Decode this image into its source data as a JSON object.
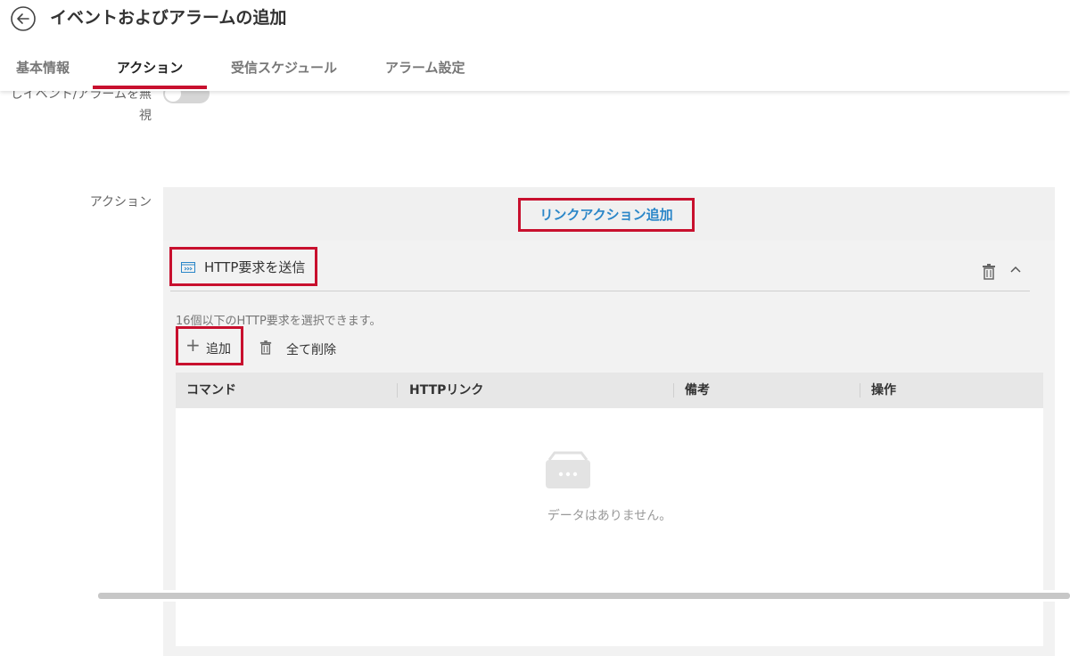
{
  "header": {
    "title": "イベントおよびアラームの追加",
    "tabs": [
      {
        "label": "基本情報",
        "active": false
      },
      {
        "label": "アクション",
        "active": true
      },
      {
        "label": "受信スケジュール",
        "active": false
      },
      {
        "label": "アラーム設定",
        "active": false
      }
    ]
  },
  "form": {
    "ignore_toggle_label_line1": "しイベント/アラームを無",
    "ignore_toggle_label_line2": "視",
    "ignore_toggle_on": false,
    "action_label": "アクション"
  },
  "actions": {
    "add_link_action_label": "リンクアクション追加",
    "http_section": {
      "title": "HTTP要求を送信",
      "hint": "16個以下のHTTP要求を選択できます。",
      "add_label": "追加",
      "delete_all_label": "全て削除",
      "table": {
        "columns": [
          "コマンド",
          "HTTPリンク",
          "備考",
          "操作"
        ],
        "rows": [],
        "empty_text": "データはありません。"
      }
    }
  },
  "colors": {
    "accent_red": "#c8102e",
    "link_blue": "#2a86c8"
  },
  "icons": {
    "back": "back-arrow-icon",
    "http": "http-request-icon",
    "trash": "trash-icon",
    "collapse": "chevron-up-icon",
    "add": "plus-icon",
    "empty": "empty-box-icon"
  }
}
